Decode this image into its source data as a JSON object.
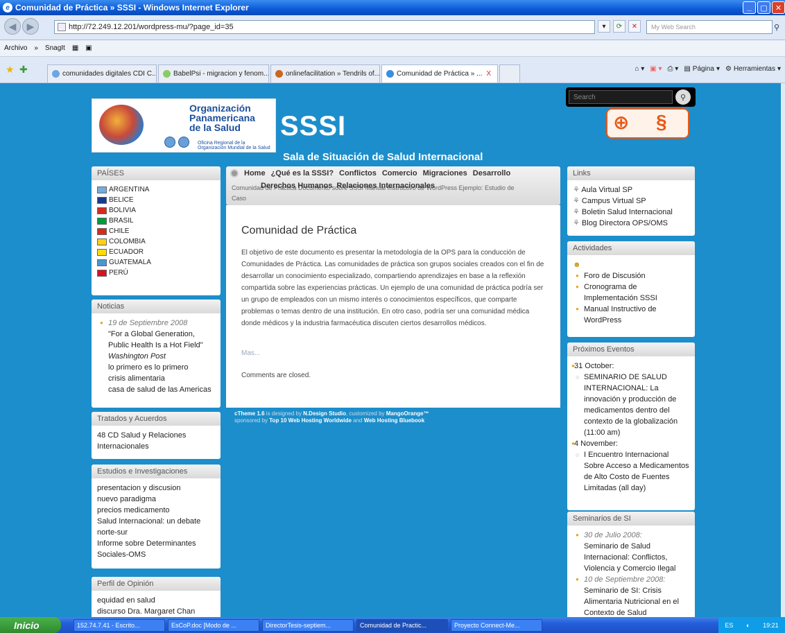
{
  "window": {
    "title": "Comunidad de Práctica » SSSI - Windows Internet Explorer",
    "controls": [
      "_",
      "▢",
      "✕"
    ]
  },
  "address": {
    "url": "http://72.249.12.201/wordpress-mu/?page_id=35",
    "search_placeholder": "My Web Search"
  },
  "menu": {
    "archivo": "Archivo",
    "more": "»",
    "snagit": "SnagIt"
  },
  "tabs": [
    {
      "label": "comunidades digitales CDI C..."
    },
    {
      "label": "BabelPsi - migracion y fenom..."
    },
    {
      "label": "onlinefacilitation » Tendrils of..."
    },
    {
      "label": "Comunidad de Práctica » ...",
      "close": "X"
    }
  ],
  "commands": {
    "pagina": "Página",
    "herramientas": "Herramientas"
  },
  "header": {
    "org_line1": "Organización",
    "org_line2": "Panamericana",
    "org_line3": "de la Salud",
    "org_small1": "Oficina Regional de la",
    "org_small2": "Organización Mundial de la Salud",
    "sssi": "SSSI",
    "subtitle": "Sala de Situación de Salud Internacional",
    "search_placeholder": "Search"
  },
  "paises": {
    "title": "PAÍSES",
    "items": [
      {
        "label": "ARGENTINA",
        "color": "#74acdf"
      },
      {
        "label": "BELICE",
        "color": "#1a3a8a"
      },
      {
        "label": "BOLIVIA",
        "color": "#d52b1e"
      },
      {
        "label": "BRASIL",
        "color": "#009c3b"
      },
      {
        "label": "CHILE",
        "color": "#d52b1e"
      },
      {
        "label": "COLOMBIA",
        "color": "#fcd116"
      },
      {
        "label": "ECUADOR",
        "color": "#ffdd00"
      },
      {
        "label": "GUATEMALA",
        "color": "#4997d0"
      },
      {
        "label": "PERÚ",
        "color": "#d91023"
      }
    ]
  },
  "noticias": {
    "title": "Noticias",
    "date": "19 de Septiembre 2008",
    "lines": [
      "\"For a Global Generation,",
      "Public Health Is a Hot Field\""
    ],
    "source": "Washington Post",
    "more": [
      "lo primero es lo primero",
      "crisis alimentaria",
      "casa de salud de las Americas"
    ]
  },
  "tratados": {
    "title": "Tratados y Acuerdos",
    "lines": [
      "48 CD Salud y Relaciones",
      "Internacionales"
    ]
  },
  "estudios": {
    "title": "Estudios e Investigaciones",
    "lines": [
      "presentacion y discusion",
      "nuevo paradigma",
      "precios medicamento",
      "Salud Internacional: un debate",
      "norte-sur",
      "Informe sobre Determinantes",
      "Sociales-OMS"
    ]
  },
  "perfil": {
    "title": "Perfil de Opinión",
    "lines": [
      "equidad en salud",
      "discurso Dra. Margaret Chan"
    ]
  },
  "nav": {
    "items": [
      "Home",
      "¿Qué es la SSSI?",
      "Conflictos",
      "Comercio",
      "Migraciones",
      "Desarrollo"
    ],
    "items2": [
      "Derechos Humanos",
      "Relaciones Internacionales"
    ],
    "sub": "Comunidad de Práctica   Documento sobre SSSI   Manual Instructivo de WordPress   Ejemplo: Estudio de",
    "sub2": "Caso"
  },
  "post": {
    "title": "Comunidad de Práctica",
    "body": "El objetivo de este documento es presentar la metodología de la OPS para la conducción de Comunidades de Práctica. Las comunidades de práctica son grupos sociales creados con el fin de desarrollar un conocimiento especializado, compartiendo aprendizajes en base a la reflexión compartida sobre las experiencias prácticas. Un ejemplo de una comunidad de práctica podría ser un grupo de empleados con un mismo interés o conocimientos específicos, que comparte problemas o temas dentro de una institución. En otro caso, podría ser una comunidad médica donde médicos y la industria farmacéutica discuten ciertos desarrollos médicos.",
    "more": "Mas...",
    "comments": "Comments are closed."
  },
  "footer": {
    "line1a": "cTheme 1.6",
    "line1b": " is designed by ",
    "line1c": "N.Design Studio",
    "line1d": ", customized by ",
    "line1e": "MangoOrange™",
    "line2a": "sponsored by ",
    "line2b": "Top 10 Web Hosting Worldwide",
    "line2c": " and ",
    "line2d": "Web Hosting Bluebook"
  },
  "links": {
    "title": "Links",
    "items": [
      "Aula Virtual SP",
      "Campus Virtual SP",
      "Boletin Salud Internacional",
      "Blog Directora OPS/OMS"
    ]
  },
  "actividades": {
    "title": "Actividades",
    "items": [
      "Foro de Discusión",
      "Cronograma de Implementación SSSI",
      "Manual Instructivo de WordPress"
    ]
  },
  "eventos": {
    "title": "Próximos Eventos",
    "d1": "31 October:",
    "e1": "SEMINARIO DE SALUD INTERNACIONAL: La innovación y producción de medicamentos dentro del contexto de la globalización (11:00 am)",
    "d2": "4 November:",
    "e2": "I Encuentro Internacional Sobre Acceso a Medicamentos de Alto Costo de Fuentes Limitadas (all day)"
  },
  "seminarios": {
    "title": "Seminarios de SI",
    "d1": "30 de Julio 2008:",
    "t1": "Seminario de Salud Internacional: Conflictos, Violencia y Comercio Ilegal",
    "d2": "10 de Septiembre 2008:",
    "t2": "Seminario de SI: Crisis Alimentaria Nutricional en el Contexto de Salud"
  },
  "taskbar": {
    "start": "Inicio",
    "items": [
      "152.74.7.41 - Escrito...",
      "EsCoP.doc [Modo de ...",
      "DirectorTesis-septiem...",
      "Comunidad de Practic...",
      "Proyecto Connect-Me..."
    ],
    "lang": "ES",
    "time": "19:21"
  }
}
